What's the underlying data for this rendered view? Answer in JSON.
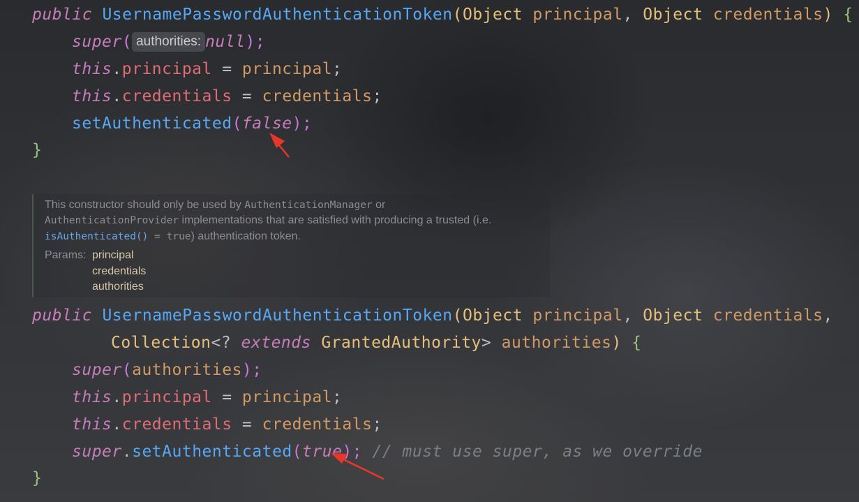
{
  "block1": {
    "sig_public": "public",
    "sig_name": "UsernamePasswordAuthenticationToken",
    "sig_open": "(",
    "sig_type1": "Object",
    "sig_param1": "principal",
    "sig_comma": ", ",
    "sig_type2": "Object",
    "sig_param2": "credentials",
    "sig_close": ")",
    "sig_brace": " {",
    "super_kw": "super",
    "super_open": "(",
    "hint_label": "authorities:",
    "null_kw": "null",
    "super_close": ");",
    "this1": "this",
    "dot1": ".",
    "field1": "principal",
    "assign1": " = ",
    "val1": "principal",
    "semi1": ";",
    "this2": "this",
    "dot2": ".",
    "field2": "credentials",
    "assign2": " = ",
    "val2": "credentials",
    "semi2": ";",
    "set_fn": "setAuthenticated",
    "set_open": "(",
    "set_arg": "false",
    "set_close": ");",
    "end_brace": "}"
  },
  "doc": {
    "line1_a": "This constructor should only be used by ",
    "line1_code": "AuthenticationManager",
    "line1_b": " or",
    "line2_code": "AuthenticationProvider",
    "line2_b": " implementations that are satisfied with producing a trusted (i.e.",
    "line3_link": "isAuthenticated()",
    "line3_eq": " = ",
    "line3_true": "true",
    "line3_b": ") authentication token.",
    "params_label": "Params:",
    "params": [
      "principal",
      "credentials",
      "authorities"
    ]
  },
  "block2": {
    "sig_public": "public",
    "sig_name": "UsernamePasswordAuthenticationToken",
    "sig_open": "(",
    "sig_type1": "Object",
    "sig_param1": "principal",
    "sig_comma1": ", ",
    "sig_type2": "Object",
    "sig_param2": "credentials",
    "sig_comma2": ",",
    "coll_type": "Collection",
    "coll_lt": "<? ",
    "extends_kw": "extends",
    "ga_type": "GrantedAuthority",
    "coll_gt": ">",
    "param3": "authorities",
    "sig_close": ")",
    "sig_brace": " {",
    "super_kw": "super",
    "super_open": "(",
    "super_arg": "authorities",
    "super_close": ");",
    "this1": "this",
    "dot1": ".",
    "field1": "principal",
    "assign1": " = ",
    "val1": "principal",
    "semi1": ";",
    "this2": "this",
    "dot2": ".",
    "field2": "credentials",
    "assign2": " = ",
    "val2": "credentials",
    "semi2": ";",
    "super2_kw": "super",
    "dot3": ".",
    "set_fn": "setAuthenticated",
    "set_open": "(",
    "set_arg": "true",
    "set_close": ");",
    "comment": " // must use super, as we override",
    "end_brace": "}"
  },
  "colors": {
    "keyword_italic": "#c77dbb",
    "function": "#56a8f5",
    "field": "#e06c75",
    "parameter": "#d19a66",
    "type": "#e5c07b",
    "comment": "#7a7e85",
    "arrow": "#e8362a"
  },
  "annotations": [
    "red-arrow-to-false",
    "red-arrow-to-true"
  ]
}
